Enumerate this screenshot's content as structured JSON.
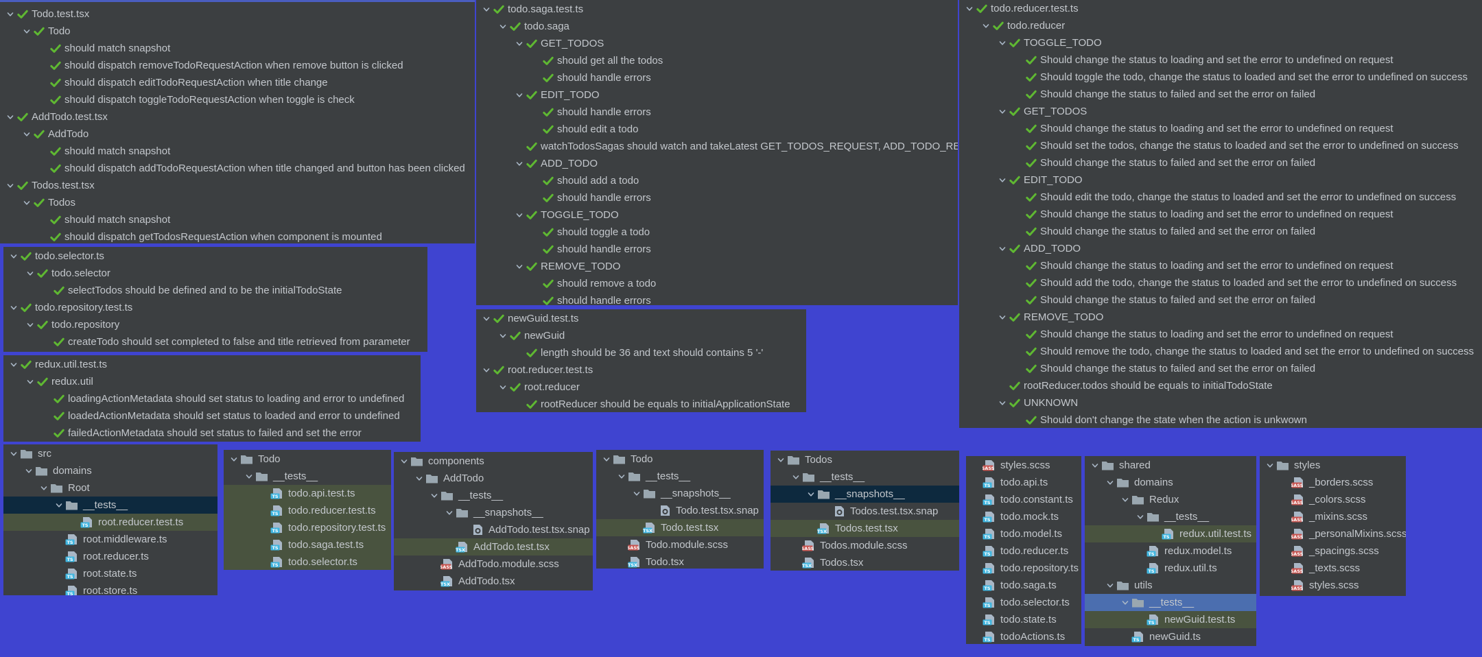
{
  "colors": {
    "background": "#3f44d0",
    "panel": "#3c3f41",
    "text": "#c3c7cc",
    "check": "#5fb832",
    "folder": "#9aa7b0",
    "tsx_badge": "#40b6e0",
    "sass_badge": "#c75450",
    "selected_dark": "#0d293e",
    "selected_green": "#49533f",
    "selected_blue": "#4b6eaf",
    "panel_border": "#4a5dbf"
  },
  "icons": {
    "expand": "chevron-down-icon",
    "pass": "check-icon",
    "folder": "folder-icon",
    "ts_file": "ts-file-icon",
    "tsx_file": "tsx-file-icon",
    "sass_file": "sass-file-icon",
    "snapshot": "snapshot-file-icon"
  },
  "panels": [
    {
      "id": "test-results-todo",
      "rows": [
        {
          "d": 0,
          "a": 1,
          "t": "Todo.test.tsx"
        },
        {
          "d": 1,
          "a": 1,
          "t": "Todo"
        },
        {
          "d": 2,
          "a": 0,
          "t": "should match snapshot"
        },
        {
          "d": 2,
          "a": 0,
          "t": "should dispatch removeTodoRequestAction when remove button is clicked"
        },
        {
          "d": 2,
          "a": 0,
          "t": "should dispatch editTodoRequestAction when title change"
        },
        {
          "d": 2,
          "a": 0,
          "t": "should dispatch toggleTodoRequestAction when toggle is check"
        },
        {
          "d": 0,
          "a": 1,
          "t": "AddTodo.test.tsx"
        },
        {
          "d": 1,
          "a": 1,
          "t": "AddTodo"
        },
        {
          "d": 2,
          "a": 0,
          "t": "should match snapshot"
        },
        {
          "d": 2,
          "a": 0,
          "t": "should dispatch addTodoRequestAction when title changed and button has been clicked"
        },
        {
          "d": 0,
          "a": 1,
          "t": "Todos.test.tsx"
        },
        {
          "d": 1,
          "a": 1,
          "t": "Todos"
        },
        {
          "d": 2,
          "a": 0,
          "t": "should match snapshot"
        },
        {
          "d": 2,
          "a": 0,
          "t": "should dispatch getTodosRequestAction when component is mounted"
        }
      ]
    },
    {
      "id": "test-results-selector",
      "rows": [
        {
          "d": 0,
          "a": 1,
          "t": "todo.selector.ts"
        },
        {
          "d": 1,
          "a": 1,
          "t": "todo.selector"
        },
        {
          "d": 2,
          "a": 0,
          "t": "selectTodos should be defined and to be the initialTodoState"
        },
        {
          "d": 0,
          "a": 1,
          "t": "todo.repository.test.ts"
        },
        {
          "d": 1,
          "a": 1,
          "t": "todo.repository"
        },
        {
          "d": 2,
          "a": 0,
          "t": "createTodo should set completed to false and title retrieved from parameter"
        }
      ]
    },
    {
      "id": "test-results-redux-util",
      "rows": [
        {
          "d": 0,
          "a": 1,
          "t": "redux.util.test.ts"
        },
        {
          "d": 1,
          "a": 1,
          "t": "redux.util"
        },
        {
          "d": 2,
          "a": 0,
          "t": "loadingActionMetadata should set status to loading and error to undefined"
        },
        {
          "d": 2,
          "a": 0,
          "t": "loadedActionMetadata should set status to loaded and error to undefined"
        },
        {
          "d": 2,
          "a": 0,
          "t": "failedActionMetadata should set status to failed and set the error"
        }
      ]
    },
    {
      "id": "test-results-saga",
      "rows": [
        {
          "d": 0,
          "a": 1,
          "t": "todo.saga.test.ts"
        },
        {
          "d": 1,
          "a": 1,
          "t": "todo.saga"
        },
        {
          "d": 2,
          "a": 1,
          "t": "GET_TODOS"
        },
        {
          "d": 3,
          "a": 0,
          "t": "should get all the todos"
        },
        {
          "d": 3,
          "a": 0,
          "t": "should handle errors"
        },
        {
          "d": 2,
          "a": 1,
          "t": "EDIT_TODO"
        },
        {
          "d": 3,
          "a": 0,
          "t": "should handle errors"
        },
        {
          "d": 3,
          "a": 0,
          "t": "should edit a todo"
        },
        {
          "d": 2,
          "a": 0,
          "t": "watchTodosSagas should watch and takeLatest GET_TODOS_REQUEST, ADD_TODO_REQUEST"
        },
        {
          "d": 2,
          "a": 1,
          "t": "ADD_TODO"
        },
        {
          "d": 3,
          "a": 0,
          "t": "should add a todo"
        },
        {
          "d": 3,
          "a": 0,
          "t": "should handle errors"
        },
        {
          "d": 2,
          "a": 1,
          "t": "TOGGLE_TODO"
        },
        {
          "d": 3,
          "a": 0,
          "t": "should toggle a todo"
        },
        {
          "d": 3,
          "a": 0,
          "t": "should handle errors"
        },
        {
          "d": 2,
          "a": 1,
          "t": "REMOVE_TODO"
        },
        {
          "d": 3,
          "a": 0,
          "t": "should remove a todo"
        },
        {
          "d": 3,
          "a": 0,
          "t": "should handle errors"
        }
      ]
    },
    {
      "id": "test-results-guid-root",
      "rows": [
        {
          "d": 0,
          "a": 1,
          "t": "newGuid.test.ts"
        },
        {
          "d": 1,
          "a": 1,
          "t": "newGuid"
        },
        {
          "d": 2,
          "a": 0,
          "t": "length should be 36 and text should contains 5 '-'"
        },
        {
          "d": 0,
          "a": 1,
          "t": "root.reducer.test.ts"
        },
        {
          "d": 1,
          "a": 1,
          "t": "root.reducer"
        },
        {
          "d": 2,
          "a": 0,
          "t": "rootReducer should be equals to initialApplicationState"
        }
      ]
    },
    {
      "id": "test-results-reducer",
      "rows": [
        {
          "d": 0,
          "a": 1,
          "t": "todo.reducer.test.ts"
        },
        {
          "d": 1,
          "a": 1,
          "t": "todo.reducer"
        },
        {
          "d": 2,
          "a": 1,
          "t": "TOGGLE_TODO"
        },
        {
          "d": 3,
          "a": 0,
          "t": "Should change the status to loading and set the error to undefined on request"
        },
        {
          "d": 3,
          "a": 0,
          "t": "Should toggle the todo, change the status to loaded and set the error to undefined on success"
        },
        {
          "d": 3,
          "a": 0,
          "t": "Should change the status to failed and set the error on failed"
        },
        {
          "d": 2,
          "a": 1,
          "t": "GET_TODOS"
        },
        {
          "d": 3,
          "a": 0,
          "t": "Should change the status to loading and set the error to undefined on request"
        },
        {
          "d": 3,
          "a": 0,
          "t": "Should set the todos, change the status to loaded and set the error to undefined on success"
        },
        {
          "d": 3,
          "a": 0,
          "t": "Should change the status to failed and set the error on failed"
        },
        {
          "d": 2,
          "a": 1,
          "t": "EDIT_TODO"
        },
        {
          "d": 3,
          "a": 0,
          "t": "Should edit the todo, change the status to loaded and set the error to undefined on success"
        },
        {
          "d": 3,
          "a": 0,
          "t": "Should change the status to loading and set the error to undefined on request"
        },
        {
          "d": 3,
          "a": 0,
          "t": "Should change the status to failed and set the error on failed"
        },
        {
          "d": 2,
          "a": 1,
          "t": "ADD_TODO"
        },
        {
          "d": 3,
          "a": 0,
          "t": "Should change the status to loading and set the error to undefined on request"
        },
        {
          "d": 3,
          "a": 0,
          "t": "Should add the todo, change the status to loaded and set the error to undefined on success"
        },
        {
          "d": 3,
          "a": 0,
          "t": "Should change the status to failed and set the error on failed"
        },
        {
          "d": 2,
          "a": 1,
          "t": "REMOVE_TODO"
        },
        {
          "d": 3,
          "a": 0,
          "t": "Should change the status to loading and set the error to undefined on request"
        },
        {
          "d": 3,
          "a": 0,
          "t": "Should remove the todo, change the status to loaded and set the error to undefined on success"
        },
        {
          "d": 3,
          "a": 0,
          "t": "Should change the status to failed and set the error on failed"
        },
        {
          "d": 2,
          "a": 0,
          "t": "rootReducer.todos should be equals to initialTodoState"
        },
        {
          "d": 2,
          "a": 1,
          "t": "UNKNOWN"
        },
        {
          "d": 3,
          "a": 0,
          "t": "Should don't change the state when the action is unkwown"
        }
      ]
    },
    {
      "id": "project-tree-src",
      "rows": [
        {
          "d": 0,
          "a": 1,
          "i": "folder",
          "t": "src"
        },
        {
          "d": 1,
          "a": 1,
          "i": "folder",
          "t": "domains"
        },
        {
          "d": 2,
          "a": 1,
          "i": "folder",
          "t": "Root"
        },
        {
          "d": 3,
          "a": 1,
          "i": "folder",
          "t": "__tests__",
          "s": "dark"
        },
        {
          "d": 4,
          "a": 0,
          "i": "ts",
          "t": "root.reducer.test.ts",
          "s": "green"
        },
        {
          "d": 3,
          "a": 0,
          "i": "ts",
          "t": "root.middleware.ts"
        },
        {
          "d": 3,
          "a": 0,
          "i": "ts",
          "t": "root.reducer.ts"
        },
        {
          "d": 3,
          "a": 0,
          "i": "ts",
          "t": "root.state.ts"
        },
        {
          "d": 3,
          "a": 0,
          "i": "ts",
          "t": "root.store.ts"
        }
      ]
    },
    {
      "id": "project-tree-todo-tests",
      "rows": [
        {
          "d": 0,
          "a": 1,
          "i": "folder",
          "t": "Todo"
        },
        {
          "d": 1,
          "a": 1,
          "i": "folder",
          "t": "__tests__"
        },
        {
          "d": 2,
          "a": 0,
          "i": "ts",
          "t": "todo.api.test.ts",
          "s": "green"
        },
        {
          "d": 2,
          "a": 0,
          "i": "ts",
          "t": "todo.reducer.test.ts",
          "s": "green"
        },
        {
          "d": 2,
          "a": 0,
          "i": "ts",
          "t": "todo.repository.test.ts",
          "s": "green"
        },
        {
          "d": 2,
          "a": 0,
          "i": "ts",
          "t": "todo.saga.test.ts",
          "s": "green"
        },
        {
          "d": 2,
          "a": 0,
          "i": "ts",
          "t": "todo.selector.ts",
          "s": "green"
        }
      ]
    },
    {
      "id": "project-tree-components",
      "rows": [
        {
          "d": 0,
          "a": 1,
          "i": "folder",
          "t": "components"
        },
        {
          "d": 1,
          "a": 1,
          "i": "folder",
          "t": "AddTodo"
        },
        {
          "d": 2,
          "a": 1,
          "i": "folder",
          "t": "__tests__"
        },
        {
          "d": 3,
          "a": 1,
          "i": "folder",
          "t": "__snapshots__"
        },
        {
          "d": 4,
          "a": 0,
          "i": "snap",
          "t": "AddTodo.test.tsx.snap"
        },
        {
          "d": 3,
          "a": 0,
          "i": "tsx",
          "t": "AddTodo.test.tsx",
          "s": "green"
        },
        {
          "d": 2,
          "a": 0,
          "i": "sass",
          "t": "AddTodo.module.scss"
        },
        {
          "d": 2,
          "a": 0,
          "i": "tsx",
          "t": "AddTodo.tsx"
        }
      ]
    },
    {
      "id": "project-tree-todo-component",
      "rows": [
        {
          "d": 0,
          "a": 1,
          "i": "folder",
          "t": "Todo"
        },
        {
          "d": 1,
          "a": 1,
          "i": "folder",
          "t": "__tests__"
        },
        {
          "d": 2,
          "a": 1,
          "i": "folder",
          "t": "__snapshots__"
        },
        {
          "d": 3,
          "a": 0,
          "i": "snap",
          "t": "Todo.test.tsx.snap"
        },
        {
          "d": 2,
          "a": 0,
          "i": "tsx",
          "t": "Todo.test.tsx",
          "s": "green"
        },
        {
          "d": 1,
          "a": 0,
          "i": "sass",
          "t": "Todo.module.scss"
        },
        {
          "d": 1,
          "a": 0,
          "i": "tsx",
          "t": "Todo.tsx"
        }
      ]
    },
    {
      "id": "project-tree-todos-component",
      "rows": [
        {
          "d": 0,
          "a": 1,
          "i": "folder",
          "t": "Todos"
        },
        {
          "d": 1,
          "a": 1,
          "i": "folder",
          "t": "__tests__"
        },
        {
          "d": 2,
          "a": 1,
          "i": "folder",
          "t": "__snapshots__",
          "s": "dark"
        },
        {
          "d": 3,
          "a": 0,
          "i": "snap",
          "t": "Todos.test.tsx.snap"
        },
        {
          "d": 2,
          "a": 0,
          "i": "tsx",
          "t": "Todos.test.tsx",
          "s": "green"
        },
        {
          "d": 1,
          "a": 0,
          "i": "sass",
          "t": "Todos.module.scss"
        },
        {
          "d": 1,
          "a": 0,
          "i": "tsx",
          "t": "Todos.tsx"
        }
      ]
    },
    {
      "id": "project-tree-todo-files",
      "rows": [
        {
          "d": 0,
          "a": 0,
          "i": "sass",
          "t": "styles.scss"
        },
        {
          "d": 0,
          "a": 0,
          "i": "ts",
          "t": "todo.api.ts"
        },
        {
          "d": 0,
          "a": 0,
          "i": "ts",
          "t": "todo.constant.ts"
        },
        {
          "d": 0,
          "a": 0,
          "i": "ts",
          "t": "todo.mock.ts"
        },
        {
          "d": 0,
          "a": 0,
          "i": "ts",
          "t": "todo.model.ts"
        },
        {
          "d": 0,
          "a": 0,
          "i": "ts",
          "t": "todo.reducer.ts"
        },
        {
          "d": 0,
          "a": 0,
          "i": "ts",
          "t": "todo.repository.ts"
        },
        {
          "d": 0,
          "a": 0,
          "i": "ts",
          "t": "todo.saga.ts"
        },
        {
          "d": 0,
          "a": 0,
          "i": "ts",
          "t": "todo.selector.ts"
        },
        {
          "d": 0,
          "a": 0,
          "i": "ts",
          "t": "todo.state.ts"
        },
        {
          "d": 0,
          "a": 0,
          "i": "ts",
          "t": "todoActions.ts"
        }
      ]
    },
    {
      "id": "project-tree-shared",
      "rows": [
        {
          "d": 0,
          "a": 1,
          "i": "folder",
          "t": "shared"
        },
        {
          "d": 1,
          "a": 1,
          "i": "folder",
          "t": "domains"
        },
        {
          "d": 2,
          "a": 1,
          "i": "folder",
          "t": "Redux"
        },
        {
          "d": 3,
          "a": 1,
          "i": "folder",
          "t": "__tests__"
        },
        {
          "d": 4,
          "a": 0,
          "i": "ts",
          "t": "redux.util.test.ts",
          "s": "green"
        },
        {
          "d": 3,
          "a": 0,
          "i": "ts",
          "t": "redux.model.ts"
        },
        {
          "d": 3,
          "a": 0,
          "i": "ts",
          "t": "redux.util.ts"
        },
        {
          "d": 1,
          "a": 1,
          "i": "folder",
          "t": "utils"
        },
        {
          "d": 2,
          "a": 1,
          "i": "folder",
          "t": "__tests__",
          "s": "blue"
        },
        {
          "d": 3,
          "a": 0,
          "i": "ts",
          "t": "newGuid.test.ts",
          "s": "green"
        },
        {
          "d": 2,
          "a": 0,
          "i": "ts",
          "t": "newGuid.ts"
        }
      ]
    },
    {
      "id": "project-tree-styles",
      "rows": [
        {
          "d": 0,
          "a": 1,
          "i": "folder",
          "t": "styles"
        },
        {
          "d": 1,
          "a": 0,
          "i": "sass",
          "t": "_borders.scss"
        },
        {
          "d": 1,
          "a": 0,
          "i": "sass",
          "t": "_colors.scss"
        },
        {
          "d": 1,
          "a": 0,
          "i": "sass",
          "t": "_mixins.scss"
        },
        {
          "d": 1,
          "a": 0,
          "i": "sass",
          "t": "_personalMixins.scss"
        },
        {
          "d": 1,
          "a": 0,
          "i": "sass",
          "t": "_spacings.scss"
        },
        {
          "d": 1,
          "a": 0,
          "i": "sass",
          "t": "_texts.scss"
        },
        {
          "d": 1,
          "a": 0,
          "i": "sass",
          "t": "styles.scss"
        }
      ]
    }
  ]
}
